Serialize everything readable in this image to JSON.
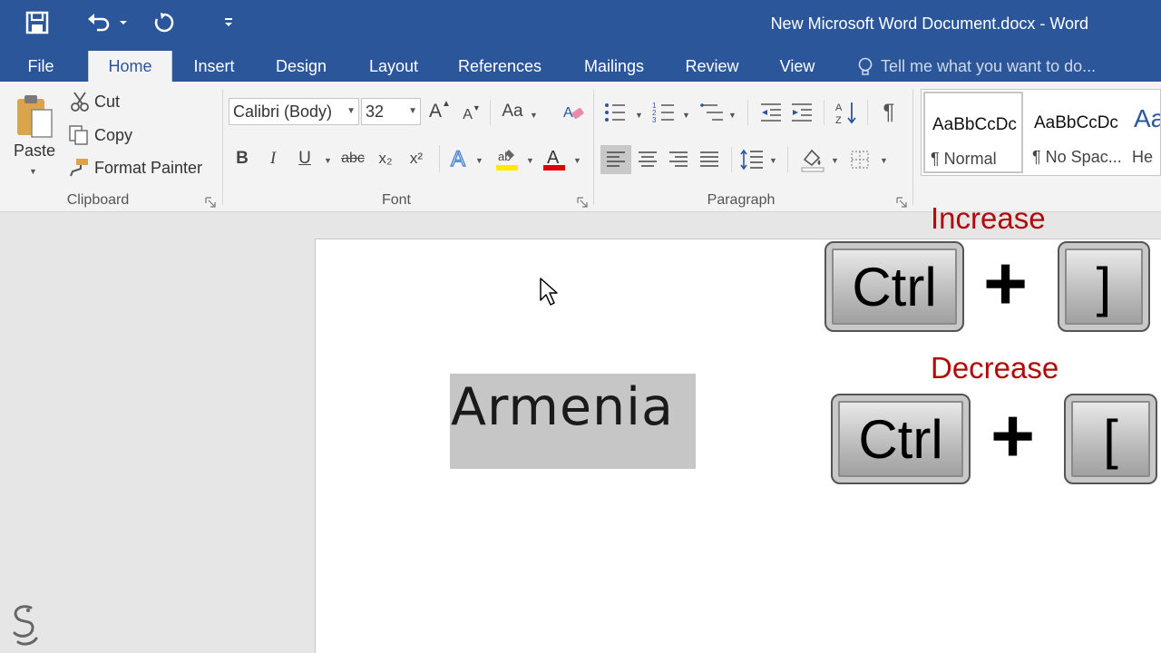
{
  "window": {
    "title": "New Microsoft Word Document.docx - Word"
  },
  "tabs": [
    {
      "label": "File"
    },
    {
      "label": "Home"
    },
    {
      "label": "Insert"
    },
    {
      "label": "Design"
    },
    {
      "label": "Layout"
    },
    {
      "label": "References"
    },
    {
      "label": "Mailings"
    },
    {
      "label": "Review"
    },
    {
      "label": "View"
    }
  ],
  "active_tab": "Home",
  "tell_me": {
    "placeholder": "Tell me what you want to do..."
  },
  "clipboard": {
    "paste": "Paste",
    "cut": "Cut",
    "copy": "Copy",
    "format_painter": "Format Painter",
    "group_label": "Clipboard"
  },
  "font": {
    "name": "Calibri (Body)",
    "size": "32",
    "group_label": "Font",
    "change_case": "Aa",
    "bold": "B",
    "italic": "I",
    "underline": "U",
    "strike": "abc",
    "subscript": "x₂",
    "superscript": "x²"
  },
  "paragraph": {
    "group_label": "Paragraph"
  },
  "styles": [
    {
      "sample": "AaBbCcDc",
      "name": "¶ Normal"
    },
    {
      "sample": "AaBbCcDc",
      "name": "¶ No Spac..."
    },
    {
      "sample": "Aa",
      "name": "He"
    }
  ],
  "document": {
    "text": "Armenia"
  },
  "shortcuts": {
    "increase": {
      "label": "Increase",
      "key1": "Ctrl",
      "plus": "+",
      "key2": "]"
    },
    "decrease": {
      "label": "Decrease",
      "key1": "Ctrl",
      "plus": "+",
      "key2": "["
    }
  },
  "colors": {
    "ribbon_blue": "#2b579a",
    "shortcut_label": "#b00b0b",
    "selection": "#c6c6c6"
  }
}
